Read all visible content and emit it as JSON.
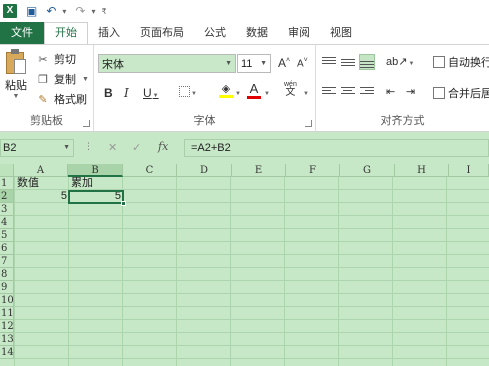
{
  "app": {
    "logo": "X",
    "quick_access": [
      "save-icon",
      "undo-icon",
      "redo-icon",
      "customize-icon"
    ]
  },
  "tabs": [
    {
      "label": "文件"
    },
    {
      "label": "开始"
    },
    {
      "label": "插入"
    },
    {
      "label": "页面布局"
    },
    {
      "label": "公式"
    },
    {
      "label": "数据"
    },
    {
      "label": "审阅"
    },
    {
      "label": "视图"
    }
  ],
  "ribbon": {
    "clipboard": {
      "paste_label": "粘贴",
      "cut_label": "剪切",
      "copy_label": "复制",
      "format_painter_label": "格式刷",
      "group_label": "剪贴板"
    },
    "font": {
      "font_name": "宋体",
      "font_size": "11",
      "grow_label": "A",
      "shrink_label": "A",
      "bold": "B",
      "italic": "I",
      "underline": "U",
      "font_color_label": "A",
      "phonetic_label": "wén",
      "phonetic_char": "文",
      "group_label": "字体"
    },
    "alignment": {
      "wrap_text_label": "自动换行",
      "merge_label": "合并后居",
      "group_label": "对齐方式"
    }
  },
  "formula_bar": {
    "name_box": "B2",
    "cancel_symbol": "✕",
    "enter_symbol": "✓",
    "fx_label": "fx",
    "formula": "=A2+B2"
  },
  "sheet": {
    "columns": [
      "A",
      "B",
      "C",
      "D",
      "E",
      "F",
      "G",
      "H",
      "I"
    ],
    "rows": [
      "1",
      "2",
      "3",
      "4",
      "5",
      "6",
      "7",
      "8",
      "9",
      "10",
      "11",
      "12",
      "13",
      "14"
    ],
    "cells": {
      "A1": "数值",
      "B1": "累加",
      "A2": "5",
      "B2": "5"
    },
    "active_cell": "B2"
  },
  "colors": {
    "accent": "#217346",
    "eye_care_background": "#c7e8c7"
  }
}
